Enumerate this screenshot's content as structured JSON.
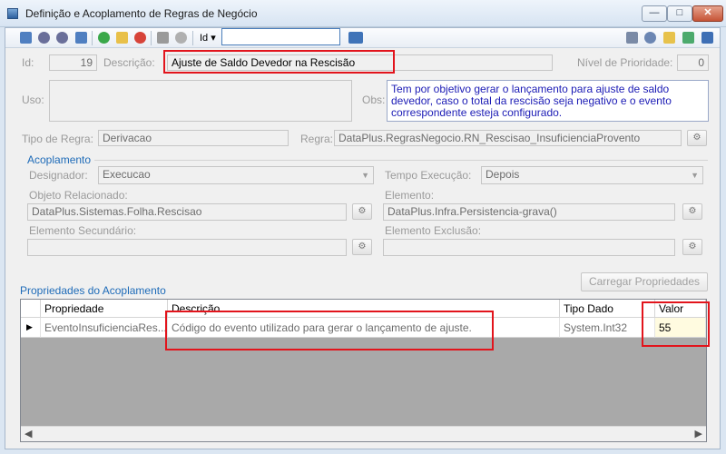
{
  "window": {
    "title": "Definição e Acoplamento de Regras de Negócio",
    "minimize": "—",
    "maximize": "□",
    "close": "✕"
  },
  "toolbar": {
    "search_field_label": "Id",
    "search_value": "",
    "colors": {
      "accent": "#4a7ebb",
      "highlight": "#e2141c"
    }
  },
  "form": {
    "id_label": "Id:",
    "id_value": "19",
    "descricao_label": "Descrição:",
    "descricao_value": "Ajuste de Saldo Devedor na Rescisão",
    "prioridade_label": "Nível de Prioridade:",
    "prioridade_value": "0",
    "uso_label": "Uso:",
    "uso_value": "",
    "obs_label": "Obs:",
    "obs_value": "Tem por objetivo gerar o lançamento para ajuste de saldo devedor, caso o total da rescisão seja negativo e o evento correspondente esteja configurado.",
    "tipo_regra_label": "Tipo de Regra:",
    "tipo_regra_value": "Derivacao",
    "regra_label": "Regra:",
    "regra_value": "DataPlus.RegrasNegocio.RN_Rescisao_InsuficienciaProvento"
  },
  "acoplamento": {
    "title": "Acoplamento",
    "designador_label": "Designador:",
    "designador_value": "Execucao",
    "tempo_label": "Tempo Execução:",
    "tempo_value": "Depois",
    "objeto_label": "Objeto Relacionado:",
    "objeto_value": "DataPlus.Sistemas.Folha.Rescisao",
    "elemento_label": "Elemento:",
    "elemento_value": "DataPlus.Infra.Persistencia-grava()",
    "secundario_label": "Elemento Secundário:",
    "secundario_value": "",
    "exclusao_label": "Elemento Exclusão:",
    "exclusao_value": ""
  },
  "propriedades": {
    "title": "Propriedades do Acoplamento",
    "load_button": "Carregar Propriedades",
    "columns": [
      "Propriedade",
      "Descrição",
      "Tipo Dado",
      "Valor"
    ],
    "rows": [
      {
        "propriedade": "EventoInsuficienciaRes...",
        "descricao": "Código do evento utilizado para gerar o lançamento de ajuste.",
        "tipo": "System.Int32",
        "valor": "55"
      }
    ]
  }
}
